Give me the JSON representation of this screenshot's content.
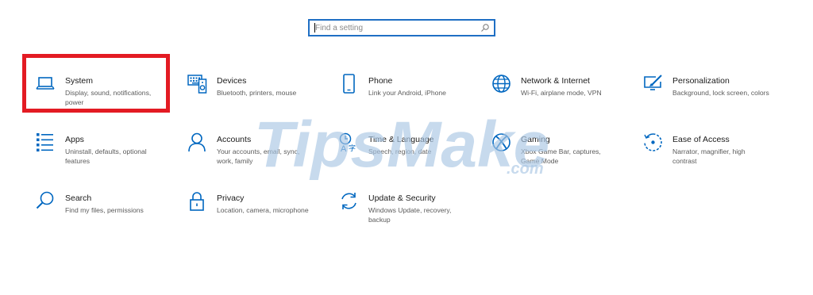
{
  "search": {
    "placeholder": "Find a setting"
  },
  "tiles": [
    {
      "title": "System",
      "desc": "Display, sound, notifications, power",
      "icon": "laptop-icon"
    },
    {
      "title": "Devices",
      "desc": "Bluetooth, printers, mouse",
      "icon": "keyboard-speaker-icon"
    },
    {
      "title": "Phone",
      "desc": "Link your Android, iPhone",
      "icon": "phone-icon"
    },
    {
      "title": "Network & Internet",
      "desc": "Wi-Fi, airplane mode, VPN",
      "icon": "globe-icon"
    },
    {
      "title": "Personalization",
      "desc": "Background, lock screen, colors",
      "icon": "paint-screen-icon"
    },
    {
      "title": "Apps",
      "desc": "Uninstall, defaults, optional features",
      "icon": "apps-list-icon"
    },
    {
      "title": "Accounts",
      "desc": "Your accounts, email, sync, work, family",
      "icon": "person-icon"
    },
    {
      "title": "Time & Language",
      "desc": "Speech, region, date",
      "icon": "time-language-icon"
    },
    {
      "title": "Gaming",
      "desc": "Xbox Game Bar, captures, Game Mode",
      "icon": "xbox-icon"
    },
    {
      "title": "Ease of Access",
      "desc": "Narrator, magnifier, high contrast",
      "icon": "ease-of-access-icon"
    },
    {
      "title": "Search",
      "desc": "Find my files, permissions",
      "icon": "search-icon"
    },
    {
      "title": "Privacy",
      "desc": "Location, camera, microphone",
      "icon": "lock-icon"
    },
    {
      "title": "Update & Security",
      "desc": "Windows Update, recovery, backup",
      "icon": "update-icon"
    }
  ],
  "watermark": {
    "text": "TipsMake",
    "suffix": ".com"
  },
  "colors": {
    "accent": "#0067c0",
    "highlight": "#e31b23",
    "watermark": "#a9c6e4"
  }
}
